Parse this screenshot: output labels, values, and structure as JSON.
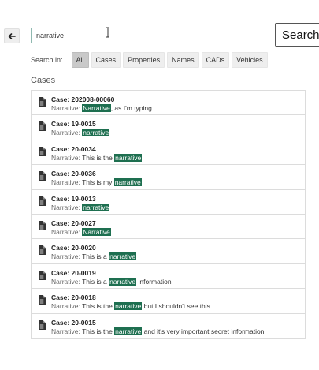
{
  "search": {
    "value": "narrative",
    "button_label": "Search"
  },
  "filters": {
    "label": "Search in:",
    "options": [
      "All",
      "Cases",
      "Properties",
      "Names",
      "CADs",
      "Vehicles"
    ],
    "selected": "All"
  },
  "section_title": "Cases",
  "results": [
    {
      "title": "Case: 202008-00060",
      "label": "Narrative:",
      "before": "",
      "match": "Narrative",
      "after": ", as I'm typing"
    },
    {
      "title": "Case: 19-0015",
      "label": "Narrative:",
      "before": "",
      "match": "narrative",
      "after": ""
    },
    {
      "title": "Case: 20-0034",
      "label": "Narrative:",
      "before": "This is the ",
      "match": "narrative",
      "after": ""
    },
    {
      "title": "Case: 20-0036",
      "label": "Narrative:",
      "before": "This is my ",
      "match": "narrative",
      "after": ""
    },
    {
      "title": "Case: 19-0013",
      "label": "Narrative:",
      "before": "",
      "match": "narrative",
      "after": ""
    },
    {
      "title": "Case: 20-0027",
      "label": "Narrative:",
      "before": "",
      "match": "Narrative",
      "after": ""
    },
    {
      "title": "Case: 20-0020",
      "label": "Narrative:",
      "before": "This is a ",
      "match": "narrative",
      "after": ""
    },
    {
      "title": "Case: 20-0019",
      "label": "Narrative:",
      "before": "This is a ",
      "match": "narrative",
      "after": " information"
    },
    {
      "title": "Case: 20-0018",
      "label": "Narrative:",
      "before": "This is the ",
      "match": "narrative",
      "after": " but I shouldn't see this."
    },
    {
      "title": "Case: 20-0015",
      "label": "Narrative:",
      "before": "This is the ",
      "match": "narrative",
      "after": " and it's very important secret information"
    }
  ],
  "icons": {
    "back": "arrow-left-icon",
    "result": "document-icon",
    "cursor": "text-cursor-icon"
  },
  "colors": {
    "highlight": "#1e6f50",
    "active_chip": "#c9c9c9",
    "search_border": "#8fb9b0"
  }
}
